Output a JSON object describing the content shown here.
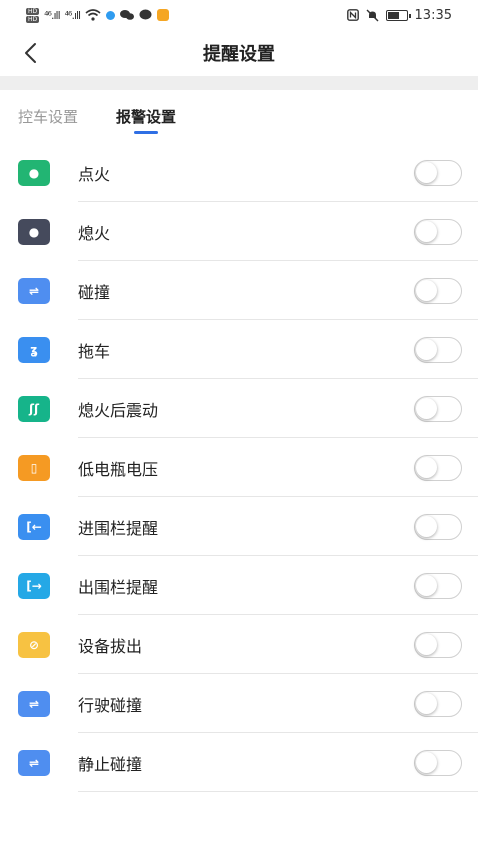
{
  "status_bar": {
    "time": "13:35",
    "signal_1": "⁴⁶.ıll",
    "signal_2": "⁴⁶.ıll",
    "hd_1": "HD",
    "hd_2": "HD"
  },
  "nav": {
    "back_glyph": "‹",
    "title": "提醒设置"
  },
  "tabs": [
    {
      "label": "控车设置",
      "active": false
    },
    {
      "label": "报警设置",
      "active": true
    }
  ],
  "items": [
    {
      "label": "点火",
      "icon": "car-start-icon",
      "icon_color": "#22b573",
      "glyph": "●",
      "enabled": false
    },
    {
      "label": "熄火",
      "icon": "car-stop-icon",
      "icon_color": "#454a5c",
      "glyph": "●",
      "enabled": false
    },
    {
      "label": "碰撞",
      "icon": "collision-icon",
      "icon_color": "#4f8ef0",
      "glyph": "⇌",
      "enabled": false
    },
    {
      "label": "拖车",
      "icon": "tow-hook-icon",
      "icon_color": "#3a8ff0",
      "glyph": "ʓ",
      "enabled": false
    },
    {
      "label": "熄火后震动",
      "icon": "vibration-icon",
      "icon_color": "#16b48a",
      "glyph": "ʃʃ",
      "enabled": false
    },
    {
      "label": "低电瓶电压",
      "icon": "low-battery-icon",
      "icon_color": "#f59a23",
      "glyph": "▯",
      "enabled": false
    },
    {
      "label": "进围栏提醒",
      "icon": "fence-enter-icon",
      "icon_color": "#3a8ff0",
      "glyph": "[←",
      "enabled": false
    },
    {
      "label": "出围栏提醒",
      "icon": "fence-exit-icon",
      "icon_color": "#25a8e6",
      "glyph": "[→",
      "enabled": false
    },
    {
      "label": "设备拔出",
      "icon": "device-unplug-icon",
      "icon_color": "#f7c242",
      "glyph": "⊘",
      "enabled": false
    },
    {
      "label": "行驶碰撞",
      "icon": "driving-collision-icon",
      "icon_color": "#4f8ef0",
      "glyph": "⇌",
      "enabled": false
    },
    {
      "label": "静止碰撞",
      "icon": "parked-collision-icon",
      "icon_color": "#4f8ef0",
      "glyph": "⇌",
      "enabled": false
    }
  ]
}
